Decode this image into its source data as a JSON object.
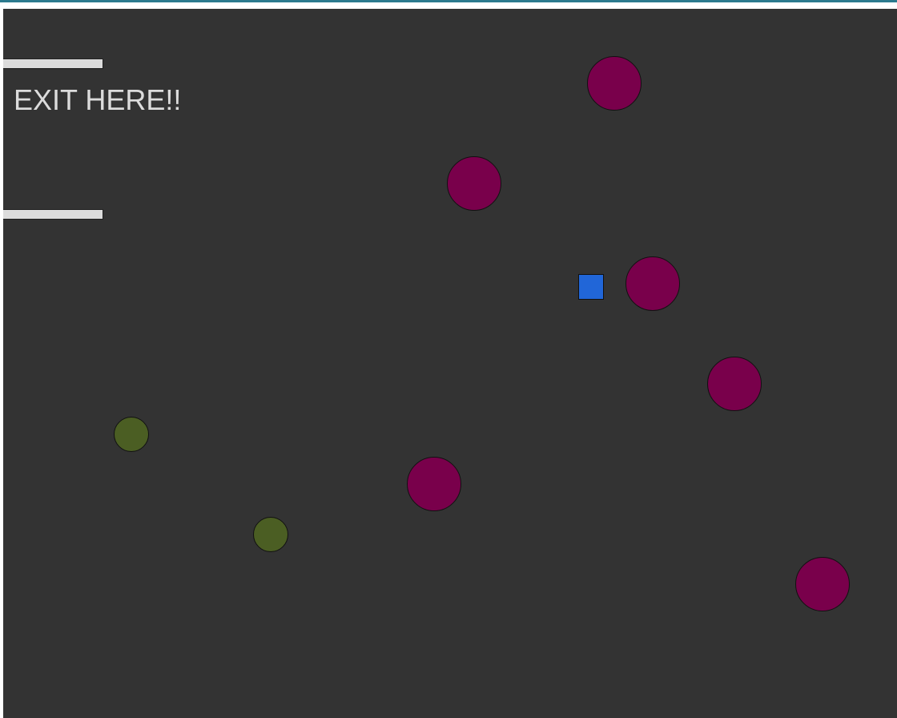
{
  "game": {
    "exit_label": "EXIT HERE!!",
    "colors": {
      "background": "#333333",
      "wall": "#dcdcdc",
      "label": "#dcdcdc",
      "enemy": "#79004b",
      "coin": "#4b5e23",
      "player": "#2166d8",
      "top_border": "#2b7a8e"
    },
    "entities": {
      "player": {
        "type": "player-square"
      },
      "enemies": [
        {
          "type": "enemy-circle"
        },
        {
          "type": "enemy-circle"
        },
        {
          "type": "enemy-circle"
        },
        {
          "type": "enemy-circle"
        },
        {
          "type": "enemy-circle"
        },
        {
          "type": "enemy-circle"
        }
      ],
      "coins": [
        {
          "type": "coin-circle"
        },
        {
          "type": "coin-circle"
        }
      ],
      "walls": [
        {
          "type": "exit-wall-top"
        },
        {
          "type": "exit-wall-bottom"
        }
      ]
    }
  }
}
